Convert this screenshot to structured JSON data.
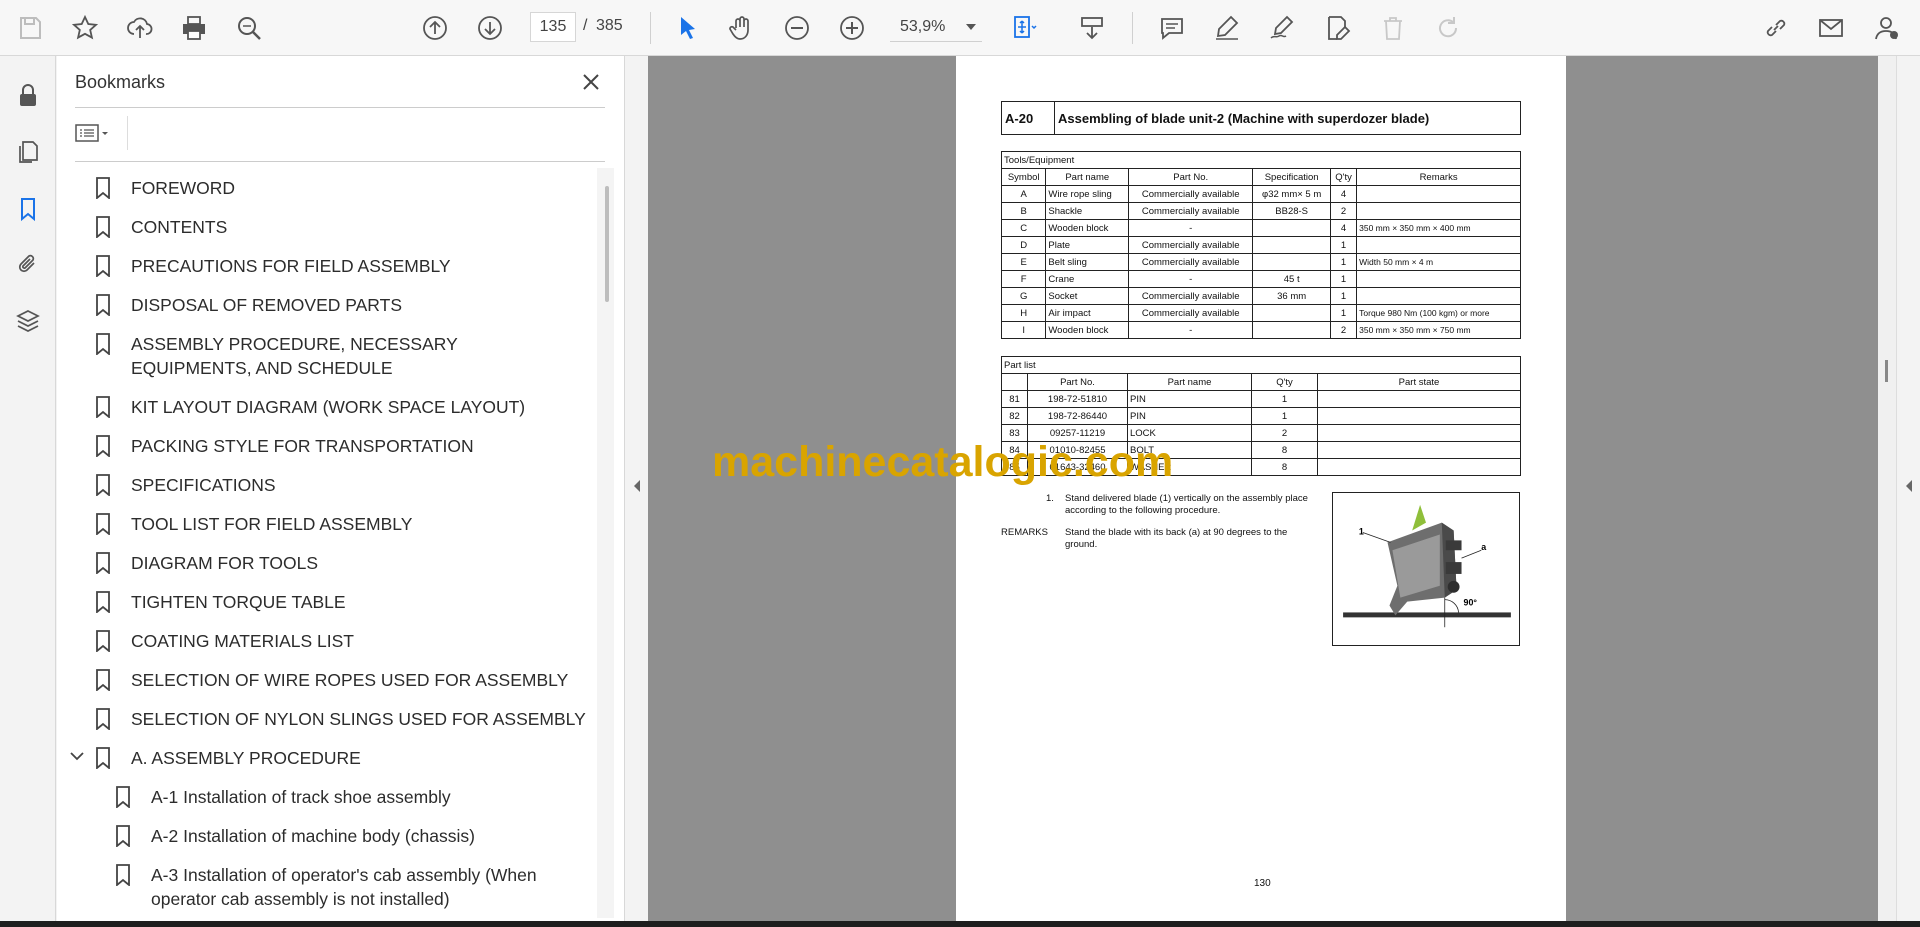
{
  "toolbar": {
    "page_current": "135",
    "page_separator": "/",
    "page_total": "385",
    "zoom": "53,9%"
  },
  "panel": {
    "title": "Bookmarks"
  },
  "bookmarks": [
    {
      "label": "FOREWORD"
    },
    {
      "label": "CONTENTS"
    },
    {
      "label": "PRECAUTIONS FOR FIELD ASSEMBLY"
    },
    {
      "label": "DISPOSAL OF REMOVED PARTS"
    },
    {
      "label": "ASSEMBLY PROCEDURE, NECESSARY EQUIPMENTS, AND SCHEDULE"
    },
    {
      "label": "KIT LAYOUT DIAGRAM (WORK SPACE LAYOUT)"
    },
    {
      "label": "PACKING STYLE FOR TRANSPORTATION"
    },
    {
      "label": "SPECIFICATIONS"
    },
    {
      "label": "TOOL LIST FOR FIELD ASSEMBLY"
    },
    {
      "label": "DIAGRAM FOR TOOLS"
    },
    {
      "label": "TIGHTEN TORQUE TABLE"
    },
    {
      "label": "COATING MATERIALS LIST"
    },
    {
      "label": "SELECTION OF WIRE ROPES USED FOR ASSEMBLY"
    },
    {
      "label": "SELECTION OF NYLON SLINGS USED FOR ASSEMBLY"
    },
    {
      "label": "A. ASSEMBLY PROCEDURE"
    },
    {
      "label": "A-1 Installation of track shoe assembly"
    },
    {
      "label": "A-2 Installation of machine body (chassis)"
    },
    {
      "label": "A-3 Installation of operator's cab assembly (When operator cab assembly is not installed)"
    }
  ],
  "document": {
    "section_code": "A-20",
    "section_title": "Assembling of blade unit-2 (Machine with superdozer blade)",
    "tools_caption": "Tools/Equipment",
    "tools_headers": [
      "Symbol",
      "Part name",
      "Part No.",
      "Specification",
      "Q'ty",
      "Remarks"
    ],
    "tools_rows": [
      [
        "A",
        "Wire rope sling",
        "Commercially available",
        "φ32 mm× 5 m",
        "4",
        ""
      ],
      [
        "B",
        "Shackle",
        "Commercially available",
        "BB28-S",
        "2",
        ""
      ],
      [
        "C",
        "Wooden block",
        "-",
        "",
        "4",
        "350 mm × 350 mm × 400 mm"
      ],
      [
        "D",
        "Plate",
        "Commercially available",
        "",
        "1",
        ""
      ],
      [
        "E",
        "Belt sling",
        "Commercially available",
        "",
        "1",
        "Width 50 mm × 4 m"
      ],
      [
        "F",
        "Crane",
        "-",
        "45 t",
        "1",
        ""
      ],
      [
        "G",
        "Socket",
        "Commercially available",
        "36 mm",
        "1",
        ""
      ],
      [
        "H",
        "Air impact",
        "Commercially available",
        "",
        "1",
        "Torque 980 Nm (100 kgm) or more"
      ],
      [
        "I",
        "Wooden block",
        "-",
        "",
        "2",
        "350 mm × 350 mm × 750 mm"
      ]
    ],
    "parts_caption": "Part list",
    "parts_headers": [
      "",
      "Part No.",
      "Part name",
      "Q'ty",
      "Part state"
    ],
    "parts_rows": [
      [
        "81",
        "198-72-51810",
        "PIN",
        "1",
        ""
      ],
      [
        "82",
        "198-72-86440",
        "PIN",
        "1",
        ""
      ],
      [
        "83",
        "09257-11219",
        "LOCK",
        "2",
        ""
      ],
      [
        "84",
        "01010-82455",
        "BOLT",
        "8",
        ""
      ],
      [
        "85",
        "01643-32460",
        "WASHER",
        "8",
        ""
      ]
    ],
    "step1_num": "1.",
    "step1_text": "Stand delivered blade (1) vertically on the assembly place according to the following procedure.",
    "remarks_label": "REMARKS",
    "remarks_text": "Stand the blade with its back (a) at 90 degrees to the ground.",
    "figure_label_1": "1",
    "figure_label_a": "a",
    "figure_angle": "90°",
    "page_number": "130"
  },
  "watermark": "machinecatalogic.com"
}
